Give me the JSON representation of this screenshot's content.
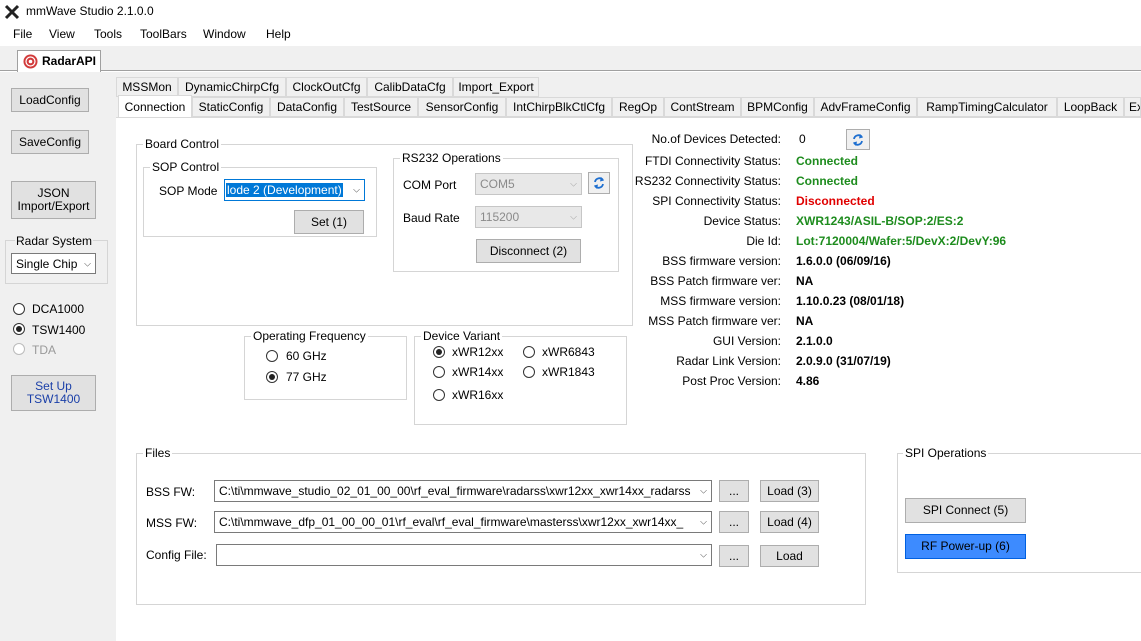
{
  "window": {
    "title": "mmWave Studio 2.1.0.0"
  },
  "menu": [
    "File",
    "View",
    "Tools",
    "ToolBars",
    "Window",
    "Help"
  ],
  "doc_tab": "RadarAPI",
  "left": {
    "load_config": "LoadConfig",
    "save_config": "SaveConfig",
    "json_line1": "JSON",
    "json_line2": "Import/Export",
    "radar_system_label": "Radar System",
    "radar_system_value": "Single Chip",
    "dca1000": "DCA1000",
    "tsw1400": "TSW1400",
    "tda": "TDA",
    "setup_line1": "Set Up",
    "setup_line2": "TSW1400"
  },
  "tabs_row1": [
    "MSSMon",
    "DynamicChirpCfg",
    "ClockOutCfg",
    "CalibDataCfg",
    "Import_Export"
  ],
  "tabs_row2": [
    "Connection",
    "StaticConfig",
    "DataConfig",
    "TestSource",
    "SensorConfig",
    "IntChirpBlkCtlCfg",
    "RegOp",
    "ContStream",
    "BPMConfig",
    "AdvFrameConfig",
    "RampTimingCalculator",
    "LoopBack",
    "Ex"
  ],
  "board_control": {
    "title": "Board Control",
    "sop_title": "SOP Control",
    "sop_mode_label": "SOP Mode",
    "sop_mode_value": "lode 2 (Development)",
    "set_button": "Set (1)",
    "rs232_title": "RS232 Operations",
    "com_port_label": "COM Port",
    "com_port_value": "COM5",
    "baud_rate_label": "Baud Rate",
    "baud_rate_value": "115200",
    "disconnect_button": "Disconnect (2)"
  },
  "operating_frequency": {
    "title": "Operating Frequency",
    "opt1": "60 GHz",
    "opt2": "77 GHz",
    "selected": "77 GHz"
  },
  "device_variant": {
    "title": "Device Variant",
    "opt1": "xWR12xx",
    "opt2": "xWR6843",
    "opt3": "xWR14xx",
    "opt4": "xWR1843",
    "opt5": "xWR16xx",
    "selected": "xWR12xx"
  },
  "status": {
    "num_devices_label": "No.of Devices Detected:",
    "num_devices_value": "0",
    "ftdi_label": "FTDI Connectivity Status:",
    "ftdi_value": "Connected",
    "rs232_label": "RS232 Connectivity Status:",
    "rs232_value": "Connected",
    "spi_label": "SPI Connectivity Status:",
    "spi_value": "Disconnected",
    "device_status_label": "Device Status:",
    "device_status_value": "XWR1243/ASIL-B/SOP:2/ES:2",
    "die_id_label": "Die Id:",
    "die_id_value": "Lot:7120004/Wafer:5/DevX:2/DevY:96",
    "bss_fw_label": "BSS firmware version:",
    "bss_fw_value": "1.6.0.0 (06/09/16)",
    "bss_patch_label": "BSS Patch firmware ver:",
    "bss_patch_value": "NA",
    "mss_fw_label": "MSS firmware version:",
    "mss_fw_value": "1.10.0.23 (08/01/18)",
    "mss_patch_label": "MSS Patch firmware ver:",
    "mss_patch_value": "NA",
    "gui_label": "GUI Version:",
    "gui_value": "2.1.0.0",
    "radar_link_label": "Radar Link Version:",
    "radar_link_value": "2.0.9.0 (31/07/19)",
    "post_proc_label": "Post Proc Version:",
    "post_proc_value": "4.86"
  },
  "files": {
    "title": "Files",
    "bss_label": "BSS FW:",
    "bss_path": "C:\\ti\\mmwave_studio_02_01_00_00\\rf_eval_firmware\\radarss\\xwr12xx_xwr14xx_radarss",
    "bss_browse": "...",
    "bss_load": "Load (3)",
    "mss_label": "MSS FW:",
    "mss_path": "C:\\ti\\mmwave_dfp_01_00_00_01\\rf_eval\\rf_eval_firmware\\masterss\\xwr12xx_xwr14xx_",
    "mss_browse": "...",
    "mss_load": "Load (4)",
    "cfg_label": "Config File:",
    "cfg_path": "",
    "cfg_browse": "...",
    "cfg_load": "Load"
  },
  "spi": {
    "title": "SPI Operations",
    "connect": "SPI Connect (5)",
    "power_up": "RF Power-up (6)"
  }
}
